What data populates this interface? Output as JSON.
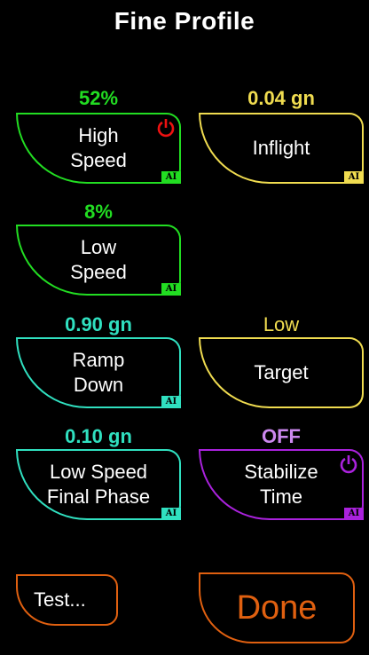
{
  "title": "Fine Profile",
  "colors": {
    "green": "#22dd22",
    "yellow": "#f0dc50",
    "teal": "#30e0c0",
    "purple": "#aa22dd",
    "orange": "#e06010",
    "power_red": "#ee1111",
    "power_purple": "#aa22dd"
  },
  "badge_text": "AI",
  "params": {
    "high_speed": {
      "value": "52%",
      "label": "High\nSpeed",
      "power_icon": "power-icon"
    },
    "inflight": {
      "value": "0.04 gn",
      "label": "Inflight"
    },
    "low_speed": {
      "value": "8%",
      "label": "Low\nSpeed"
    },
    "ramp_down": {
      "value": "0.90 gn",
      "label": "Ramp\nDown"
    },
    "target": {
      "value": "Low",
      "label": "Target"
    },
    "low_speed_final": {
      "value": "0.10 gn",
      "label": "Low Speed\nFinal Phase"
    },
    "stabilize_time": {
      "value": "OFF",
      "label": "Stabilize\nTime",
      "power_icon": "power-icon"
    }
  },
  "buttons": {
    "test": "Test...",
    "done": "Done"
  }
}
